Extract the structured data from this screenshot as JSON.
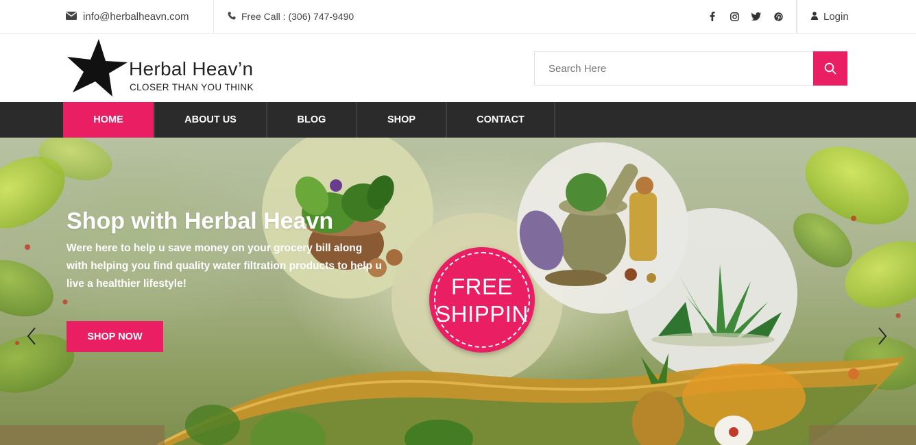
{
  "topbar": {
    "email": "info@herbalheavn.com",
    "phone": "Free Call : (306) 747-9490",
    "social": [
      "facebook-icon",
      "instagram-icon",
      "twitter-icon",
      "pinterest-icon"
    ],
    "login": "Login"
  },
  "header": {
    "logo_title": "Herbal Heav’n",
    "logo_tagline": "CLOSER THAN YOU THINK",
    "search_placeholder": "Search Here"
  },
  "nav": {
    "items": [
      {
        "label": "HOME",
        "active": true
      },
      {
        "label": "ABOUT US"
      },
      {
        "label": "BLOG"
      },
      {
        "label": "SHOP"
      },
      {
        "label": "CONTACT"
      }
    ]
  },
  "hero": {
    "title": "Shop with Herbal Heavn",
    "text": "Were here to help u save money on your grocery bill along with helping you find quality water filtration products to help u live a healthier lifestyle!",
    "button": "SHOP NOW",
    "badge_line1": "FREE",
    "badge_line2": "SHIPPIN"
  },
  "colors": {
    "accent": "#e91e63",
    "nav_bg": "#2b2b2b",
    "text_dark": "#222222"
  }
}
